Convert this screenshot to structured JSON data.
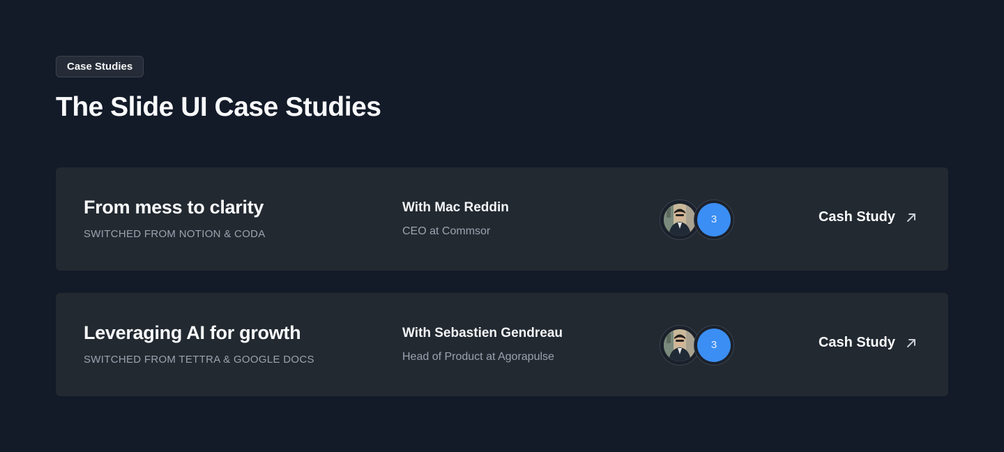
{
  "header": {
    "badge": "Case Studies",
    "title": "The Slide UI Case Studies"
  },
  "cards": [
    {
      "title": "From mess to clarity",
      "subtitle": "SWITCHED FROM NOTION & CODA",
      "person_name": "With Mac Reddin",
      "person_role": "CEO at Commsor",
      "avatar_icon": "person-photo-icon",
      "avatar_count": "3",
      "cta_label": "Cash Study",
      "cta_icon": "arrow-up-right-icon"
    },
    {
      "title": "Leveraging AI for growth",
      "subtitle": "SWITCHED FROM TETTRA & GOOGLE DOCS",
      "person_name": "With Sebastien Gendreau",
      "person_role": "Head of Product at Agorapulse",
      "avatar_icon": "person-photo-icon",
      "avatar_count": "3",
      "cta_label": "Cash Study",
      "cta_icon": "arrow-up-right-icon"
    }
  ],
  "colors": {
    "background": "#131a28",
    "card": "#222931",
    "accent": "#3b8ef3"
  }
}
